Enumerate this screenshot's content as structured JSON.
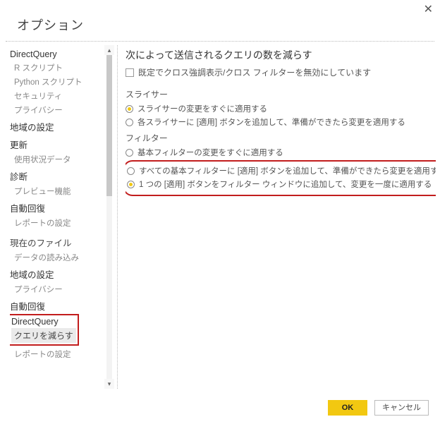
{
  "dialog": {
    "title": "オプション",
    "close_glyph": "✕"
  },
  "sidebar": {
    "items": [
      {
        "label": "DirectQuery",
        "kind": "group"
      },
      {
        "label": "R スクリプト",
        "kind": "item"
      },
      {
        "label": "Python スクリプト",
        "kind": "item"
      },
      {
        "label": "セキュリティ",
        "kind": "item"
      },
      {
        "label": "プライバシー",
        "kind": "item"
      },
      {
        "label": "地域の設定",
        "kind": "group"
      },
      {
        "label": "更新",
        "kind": "group"
      },
      {
        "label": "使用状況データ",
        "kind": "item"
      },
      {
        "label": "診断",
        "kind": "group"
      },
      {
        "label": "プレビュー機能",
        "kind": "item"
      },
      {
        "label": "自動回復",
        "kind": "group"
      },
      {
        "label": "レポートの設定",
        "kind": "item"
      },
      {
        "label": "現在のファイル",
        "kind": "section"
      },
      {
        "label": "データの読み込み",
        "kind": "item"
      },
      {
        "label": "地域の設定",
        "kind": "group"
      },
      {
        "label": "プライバシー",
        "kind": "item"
      },
      {
        "label": "自動回復",
        "kind": "group"
      },
      {
        "label": "DirectQuery",
        "kind": "group"
      },
      {
        "label": "クエリを減らす",
        "kind": "selected"
      },
      {
        "label": "レポートの設定",
        "kind": "item"
      }
    ]
  },
  "main": {
    "heading": "次によって送信されるクエリの数を減らす",
    "checkbox_label": "既定でクロス強調表示/クロス フィルターを無効にしています",
    "slicer_heading": "スライサー",
    "slicer_options": [
      "スライサーの変更をすぐに適用する",
      "各スライサーに [適用] ボタンを追加して、準備ができたら変更を適用する"
    ],
    "filter_heading": "フィルター",
    "filter_options": [
      "基本フィルターの変更をすぐに適用する",
      "すべての基本フィルターに [適用] ボタンを追加して、準備ができたら変更を適用する",
      "1 つの [適用] ボタンをフィルター ウィンドウに追加して、変更を一度に適用する"
    ]
  },
  "footer": {
    "ok": "OK",
    "cancel": "キャンセル"
  },
  "glyphs": {
    "up": "▴",
    "down": "▾"
  }
}
